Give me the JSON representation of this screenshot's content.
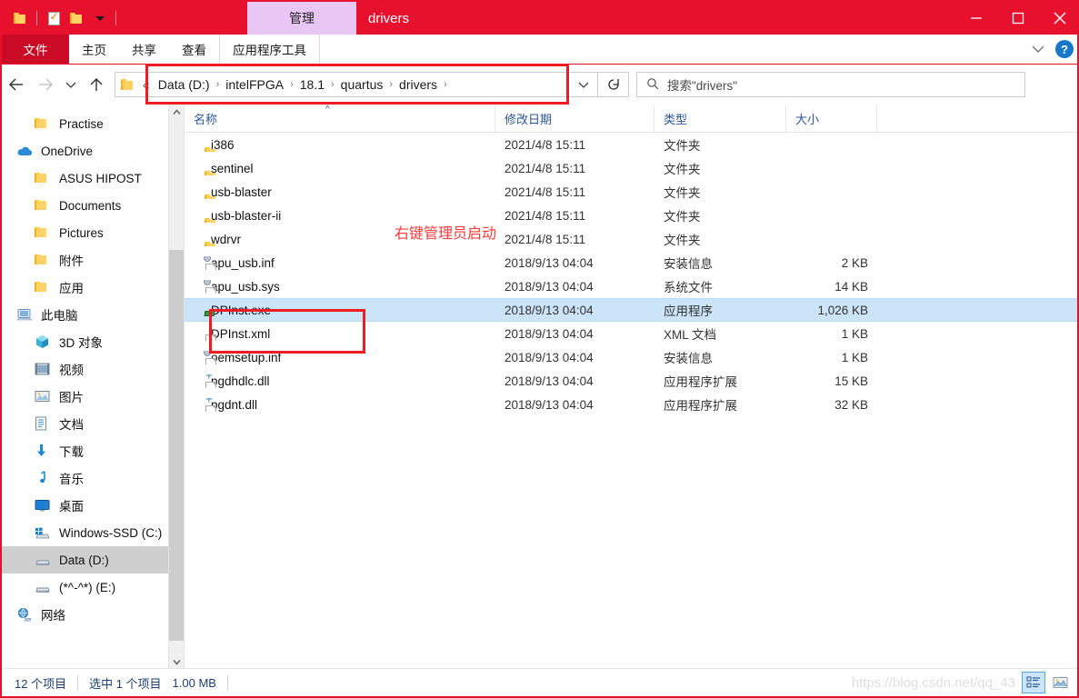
{
  "window": {
    "title": "drivers",
    "contextual_tab": "管理",
    "controls": {
      "minimize": "minimize-icon",
      "maximize": "maximize-icon",
      "close": "close-icon"
    },
    "quick_access": [
      {
        "name": "folder-icon",
        "icon": "folder-icon"
      },
      {
        "name": "properties-icon",
        "icon": "properties-checkbox-icon"
      },
      {
        "name": "new-folder-icon",
        "icon": "folder-icon"
      },
      {
        "name": "customize-qat-icon",
        "icon": "chevron-down-icon"
      }
    ]
  },
  "ribbon": {
    "tabs": [
      {
        "label": "文件",
        "active": true
      },
      {
        "label": "主页",
        "active": false
      },
      {
        "label": "共享",
        "active": false
      },
      {
        "label": "查看",
        "active": false
      },
      {
        "label": "应用程序工具",
        "active": false
      }
    ],
    "collapse_icon": "chevron-down-icon",
    "help_label": "?"
  },
  "addressbar": {
    "back_icon": "arrow-left-icon",
    "forward_icon": "arrow-right-icon",
    "recent_icon": "chevron-down-icon",
    "up_icon": "arrow-up-icon",
    "folder_icon": "folder-icon",
    "ellipsis": "«",
    "crumbs": [
      "Data (D:)",
      "intelFPGA",
      "18.1",
      "quartus",
      "drivers"
    ],
    "separator": "›",
    "dropdown_icon": "chevron-down-icon",
    "refresh_icon": "refresh-icon",
    "search_icon": "search-icon",
    "search_placeholder": "搜索\"drivers\""
  },
  "sidebar": {
    "items": [
      {
        "label": "Practise",
        "icon": "folder-icon",
        "indent": 1,
        "selected": false
      },
      {
        "label": "OneDrive",
        "icon": "onedrive-cloud-icon",
        "indent": 0,
        "selected": false
      },
      {
        "label": "ASUS HIPOST",
        "icon": "folder-icon",
        "indent": 1,
        "selected": false
      },
      {
        "label": "Documents",
        "icon": "folder-icon",
        "indent": 1,
        "selected": false
      },
      {
        "label": "Pictures",
        "icon": "folder-icon",
        "indent": 1,
        "selected": false
      },
      {
        "label": "附件",
        "icon": "folder-icon",
        "indent": 1,
        "selected": false
      },
      {
        "label": "应用",
        "icon": "folder-icon",
        "indent": 1,
        "selected": false
      },
      {
        "label": "此电脑",
        "icon": "this-pc-icon",
        "indent": 0,
        "selected": false
      },
      {
        "label": "3D 对象",
        "icon": "3d-objects-icon",
        "indent": 1,
        "selected": false
      },
      {
        "label": "视频",
        "icon": "videos-icon",
        "indent": 1,
        "selected": false
      },
      {
        "label": "图片",
        "icon": "pictures-icon",
        "indent": 1,
        "selected": false
      },
      {
        "label": "文档",
        "icon": "documents-icon",
        "indent": 1,
        "selected": false
      },
      {
        "label": "下载",
        "icon": "downloads-icon",
        "indent": 1,
        "selected": false
      },
      {
        "label": "音乐",
        "icon": "music-icon",
        "indent": 1,
        "selected": false
      },
      {
        "label": "桌面",
        "icon": "desktop-icon",
        "indent": 1,
        "selected": false
      },
      {
        "label": "Windows-SSD (C:)",
        "icon": "windows-drive-icon",
        "indent": 1,
        "selected": false
      },
      {
        "label": "Data (D:)",
        "icon": "drive-icon",
        "indent": 1,
        "selected": true
      },
      {
        "label": "(*^-^*)  (E:)",
        "icon": "drive-icon",
        "indent": 1,
        "selected": false
      },
      {
        "label": "网络",
        "icon": "network-icon",
        "indent": 0,
        "selected": false
      }
    ],
    "scroll_up_icon": "chevron-up-icon",
    "scroll_down_icon": "chevron-down-icon"
  },
  "filelist": {
    "columns": [
      {
        "label": "名称",
        "sorted": "asc"
      },
      {
        "label": "修改日期",
        "sorted": ""
      },
      {
        "label": "类型",
        "sorted": ""
      },
      {
        "label": "大小",
        "sorted": ""
      }
    ],
    "sort_arrow": "^",
    "rows": [
      {
        "name": "i386",
        "date": "2021/4/8 15:11",
        "type": "文件夹",
        "size": "",
        "icon": "folder-icon",
        "selected": false
      },
      {
        "name": "sentinel",
        "date": "2021/4/8 15:11",
        "type": "文件夹",
        "size": "",
        "icon": "folder-icon",
        "selected": false
      },
      {
        "name": "usb-blaster",
        "date": "2021/4/8 15:11",
        "type": "文件夹",
        "size": "",
        "icon": "folder-icon",
        "selected": false
      },
      {
        "name": "usb-blaster-ii",
        "date": "2021/4/8 15:11",
        "type": "文件夹",
        "size": "",
        "icon": "folder-icon",
        "selected": false
      },
      {
        "name": "wdrvr",
        "date": "2021/4/8 15:11",
        "type": "文件夹",
        "size": "",
        "icon": "folder-icon",
        "selected": false
      },
      {
        "name": "apu_usb.inf",
        "date": "2018/9/13 04:04",
        "type": "安装信息",
        "size": "2 KB",
        "icon": "inf-file-icon",
        "selected": false
      },
      {
        "name": "apu_usb.sys",
        "date": "2018/9/13 04:04",
        "type": "系统文件",
        "size": "14 KB",
        "icon": "sys-file-icon",
        "selected": false
      },
      {
        "name": "DPInst.exe",
        "date": "2018/9/13 04:04",
        "type": "应用程序",
        "size": "1,026 KB",
        "icon": "exe-file-icon",
        "selected": true
      },
      {
        "name": "DPInst.xml",
        "date": "2018/9/13 04:04",
        "type": "XML 文档",
        "size": "1 KB",
        "icon": "xml-file-icon",
        "selected": false
      },
      {
        "name": "oemsetup.inf",
        "date": "2018/9/13 04:04",
        "type": "安装信息",
        "size": "1 KB",
        "icon": "inf-file-icon",
        "selected": false
      },
      {
        "name": "pgdhdlc.dll",
        "date": "2018/9/13 04:04",
        "type": "应用程序扩展",
        "size": "15 KB",
        "icon": "dll-file-icon",
        "selected": false
      },
      {
        "name": "pgdnt.dll",
        "date": "2018/9/13 04:04",
        "type": "应用程序扩展",
        "size": "32 KB",
        "icon": "dll-file-icon",
        "selected": false
      }
    ]
  },
  "statusbar": {
    "item_count": "12 个项目",
    "selection": "选中 1 个项目",
    "selection_size": "1.00 MB",
    "watermark": "https://blog.csdn.net/qq_43",
    "views": [
      {
        "name": "details-view-button",
        "icon": "details-view-icon",
        "active": true
      },
      {
        "name": "large-icons-view-button",
        "icon": "large-icons-view-icon",
        "active": false
      }
    ]
  },
  "annotations": {
    "text_note": "右键管理员启动",
    "accent_color": "#ee1c25"
  }
}
